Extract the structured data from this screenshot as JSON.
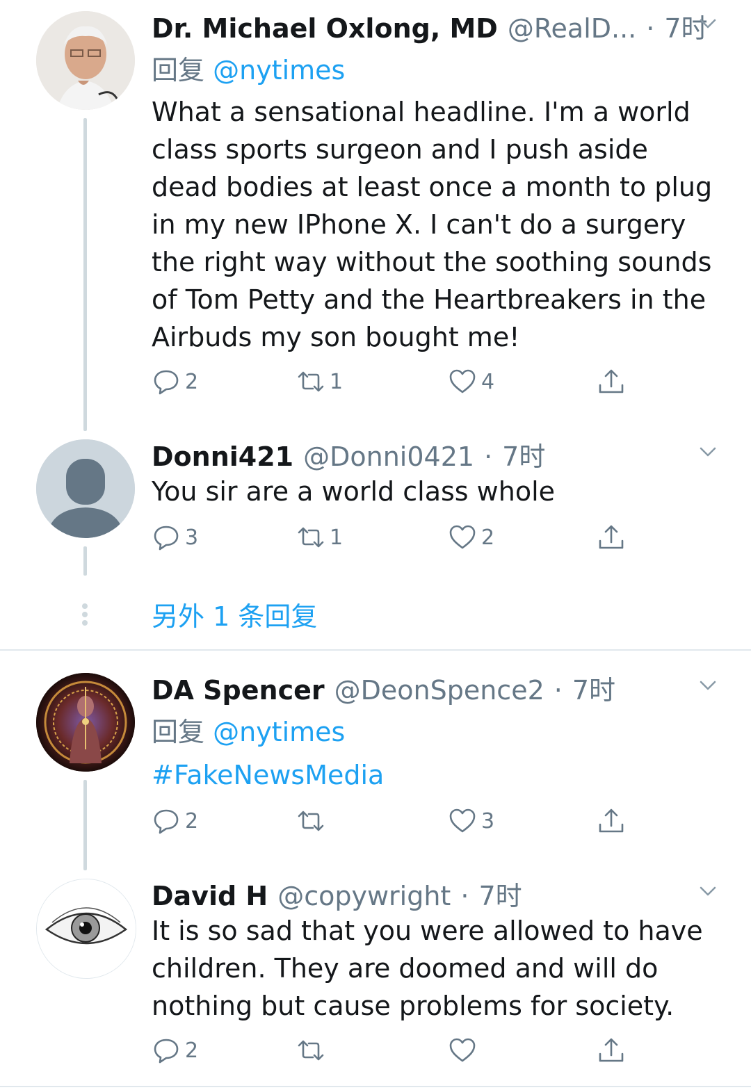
{
  "tweets": [
    {
      "name": "Dr. Michael Oxlong, MD",
      "handle": "@RealD...",
      "time": "7时",
      "reply_prefix": "回复",
      "reply_to": "@nytimes",
      "text": "What a sensational headline. I'm a world class sports surgeon and I push aside dead bodies at least once a month to plug in my new IPhone X. I can't do a surgery the right way without the soothing sounds of Tom Petty and the Heartbreakers in the Airbuds my son bought me!",
      "replies": "2",
      "retweets": "1",
      "likes": "4"
    },
    {
      "name": "Donni421",
      "handle": "@Donni0421",
      "time": "7时",
      "text": "You sir are a world class whole",
      "replies": "3",
      "retweets": "1",
      "likes": "2"
    },
    {
      "name": "DA Spencer",
      "handle": "@DeonSpence2",
      "time": "7时",
      "reply_prefix": "回复",
      "reply_to": "@nytimes",
      "text": "#FakeNewsMedia",
      "replies": "2",
      "retweets": "",
      "likes": "3"
    },
    {
      "name": "David H",
      "handle": "@copywright",
      "time": "7时",
      "text": "It is so sad that you were allowed to have children. They are doomed and will do nothing but cause problems for society.",
      "replies": "2",
      "retweets": "",
      "likes": ""
    }
  ],
  "more_replies_label": "另外 1 条回复",
  "separator": "·",
  "colors": {
    "accent": "#1da1f2",
    "secondary_text": "#657786",
    "thread_line": "#cfd9de"
  },
  "icons": [
    "reply-icon",
    "retweet-icon",
    "like-icon",
    "share-icon",
    "chevron-down-icon"
  ]
}
